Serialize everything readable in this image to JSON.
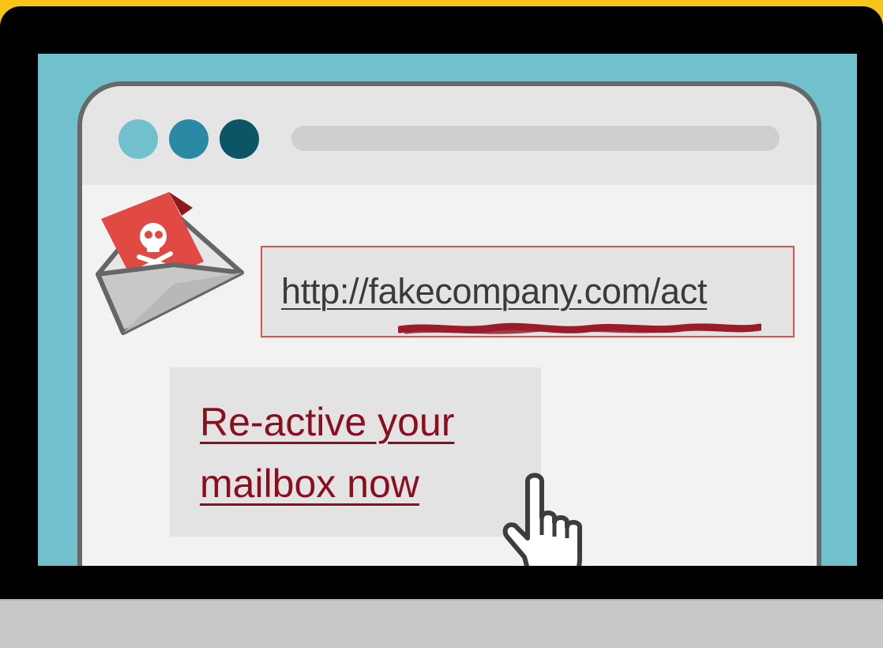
{
  "colors": {
    "background": "#f7c518",
    "screen": "#70c1cd",
    "dot_1": "#70c1cd",
    "dot_2": "#2a8aa3",
    "dot_3": "#0b5566",
    "link": "#8b0e1f",
    "warning_red": "#d9534f"
  },
  "icons": {
    "envelope": "phishing-envelope-icon",
    "skull": "skull-crossbones-icon",
    "cursor": "hand-pointer-icon"
  },
  "email": {
    "url": "http://fakecompany.com/act",
    "cta_line1": "Re-active your",
    "cta_line2": "mailbox now"
  }
}
